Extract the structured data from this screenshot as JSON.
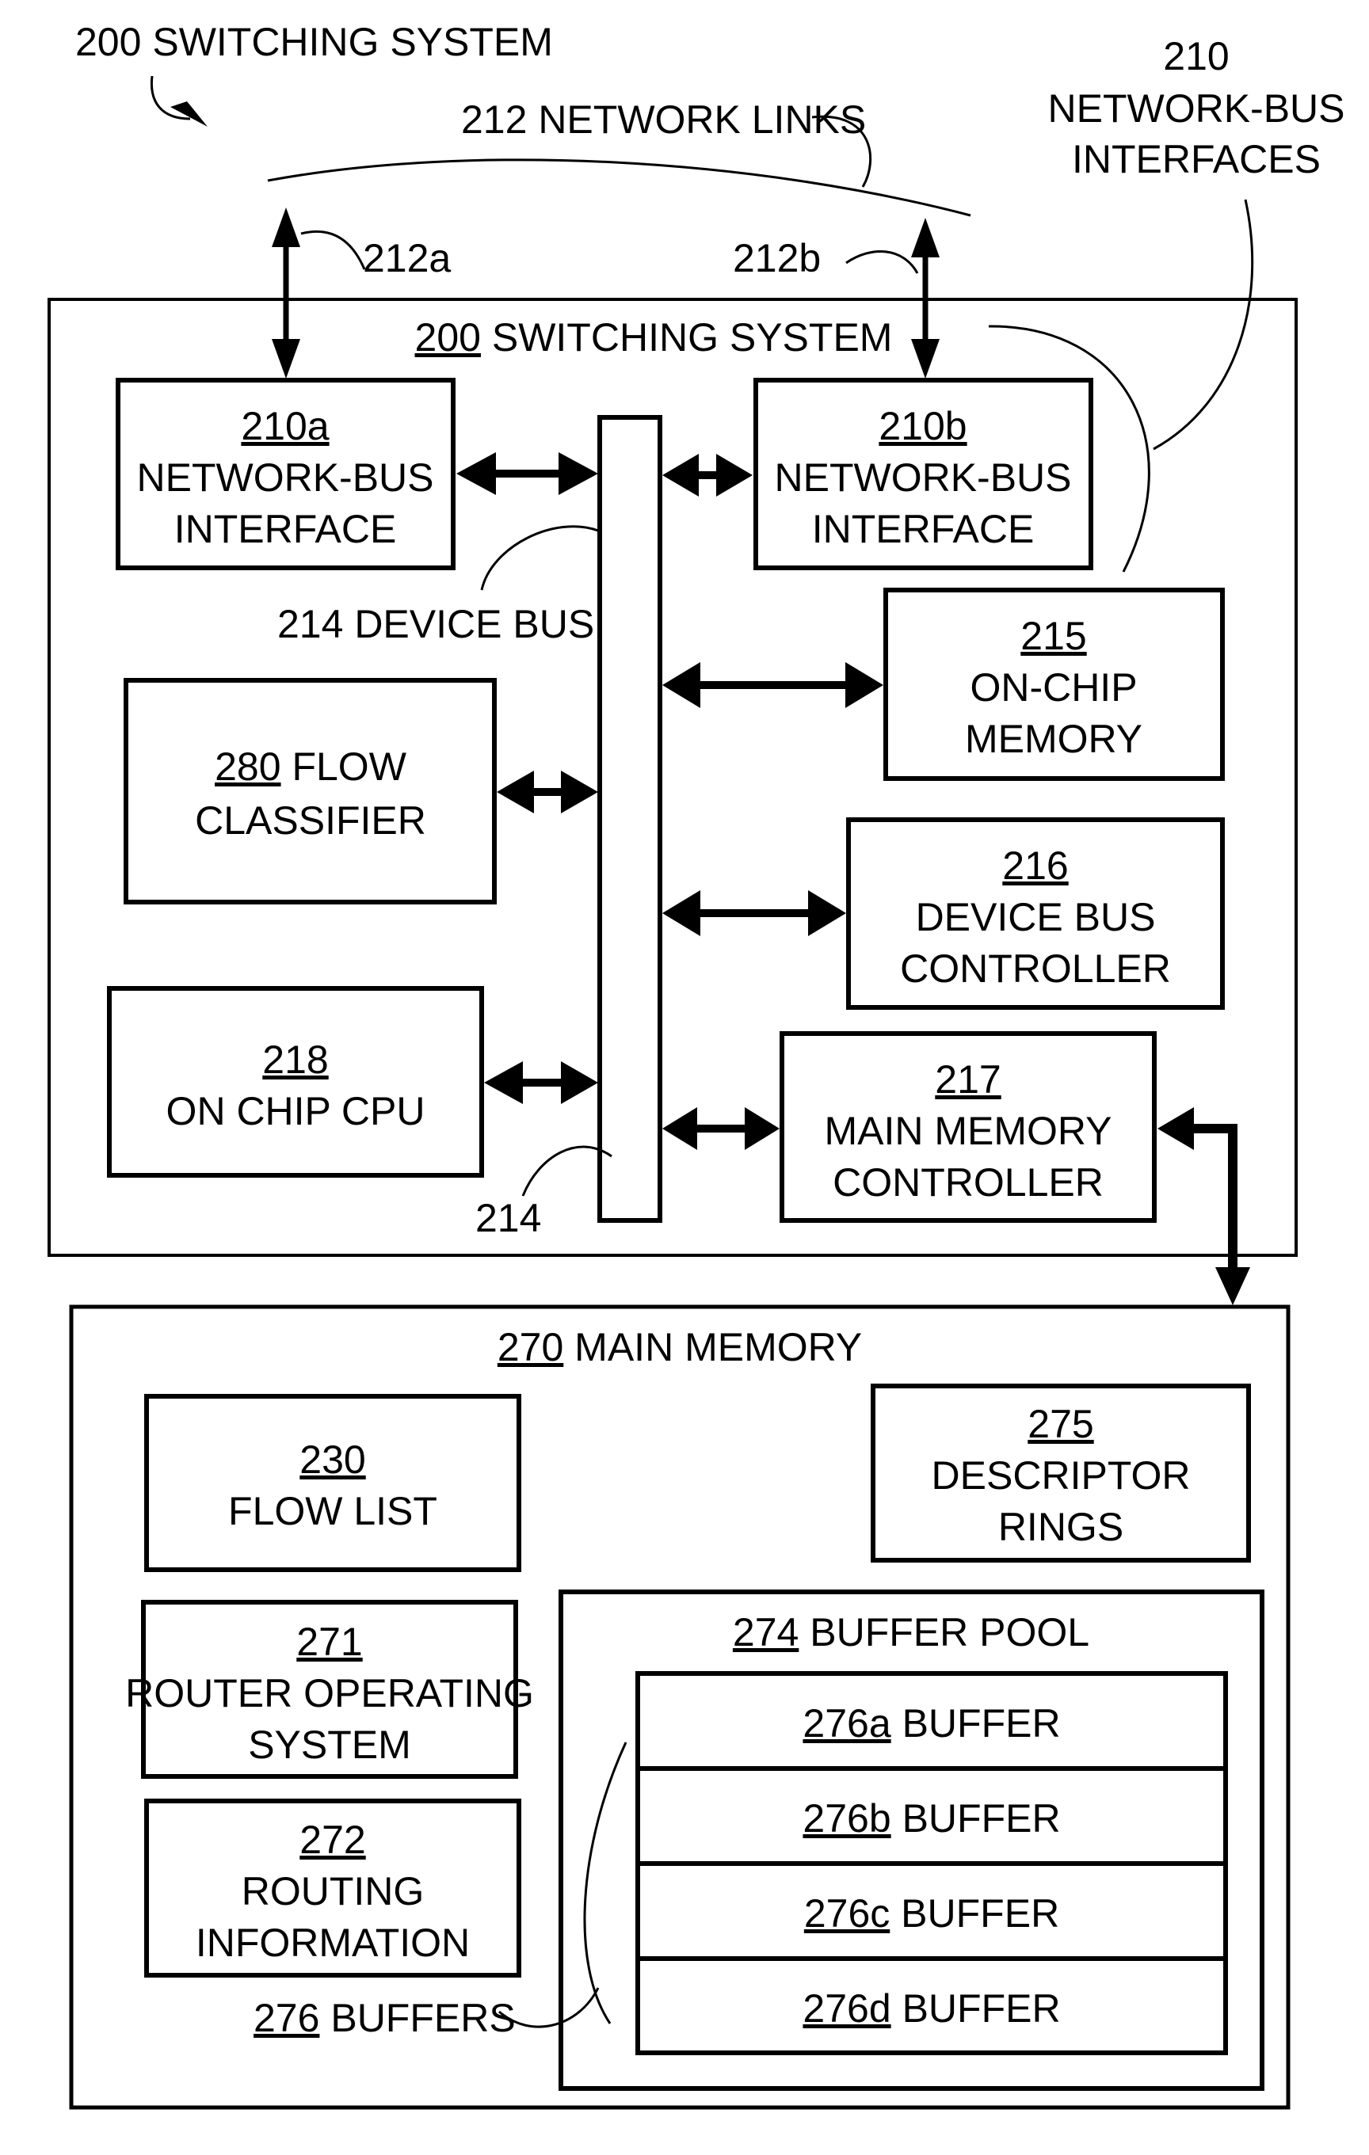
{
  "figure": {
    "title_ref": "200",
    "title_text": "SWITCHING SYSTEM",
    "callouts": {
      "network_links": "212 NETWORK LINKS",
      "link_a": "212a",
      "link_b": "212b",
      "interfaces_ref": "210",
      "interfaces_line1": "NETWORK-BUS",
      "interfaces_line2": "INTERFACES",
      "device_bus": "214 DEVICE BUS",
      "device_bus_ref": "214"
    },
    "switching_system": {
      "ref": "200",
      "label": "SWITCHING SYSTEM",
      "blocks": {
        "nbi_a": {
          "ref": "210a",
          "line1": "NETWORK-BUS",
          "line2": "INTERFACE"
        },
        "nbi_b": {
          "ref": "210b",
          "line1": "NETWORK-BUS",
          "line2": "INTERFACE"
        },
        "onchip_mem": {
          "ref": "215",
          "line1": "ON-CHIP",
          "line2": "MEMORY"
        },
        "flow_classifier": {
          "ref": "280",
          "line1": "FLOW",
          "line2": "CLASSIFIER"
        },
        "bus_controller": {
          "ref": "216",
          "line1": "DEVICE BUS",
          "line2": "CONTROLLER"
        },
        "cpu": {
          "ref": "218",
          "line1": "ON CHIP CPU"
        },
        "mem_controller": {
          "ref": "217",
          "line1": "MAIN MEMORY",
          "line2": "CONTROLLER"
        }
      }
    },
    "main_memory": {
      "ref": "270",
      "label": "MAIN MEMORY",
      "blocks": {
        "flow_list": {
          "ref": "230",
          "line1": "FLOW LIST"
        },
        "descriptor_rings": {
          "ref": "275",
          "line1": "DESCRIPTOR",
          "line2": "RINGS"
        },
        "router_os": {
          "ref": "271",
          "line1": "ROUTER OPERATING",
          "line2": "SYSTEM"
        },
        "routing_info": {
          "ref": "272",
          "line1": "ROUTING",
          "line2": "INFORMATION"
        }
      },
      "buffer_pool": {
        "ref": "274",
        "label": "BUFFER POOL",
        "buffers": [
          {
            "ref": "276a",
            "label": "BUFFER"
          },
          {
            "ref": "276b",
            "label": "BUFFER"
          },
          {
            "ref": "276c",
            "label": "BUFFER"
          },
          {
            "ref": "276d",
            "label": "BUFFER"
          }
        ]
      },
      "buffers_callout_ref": "276",
      "buffers_callout_label": "BUFFERS"
    }
  }
}
